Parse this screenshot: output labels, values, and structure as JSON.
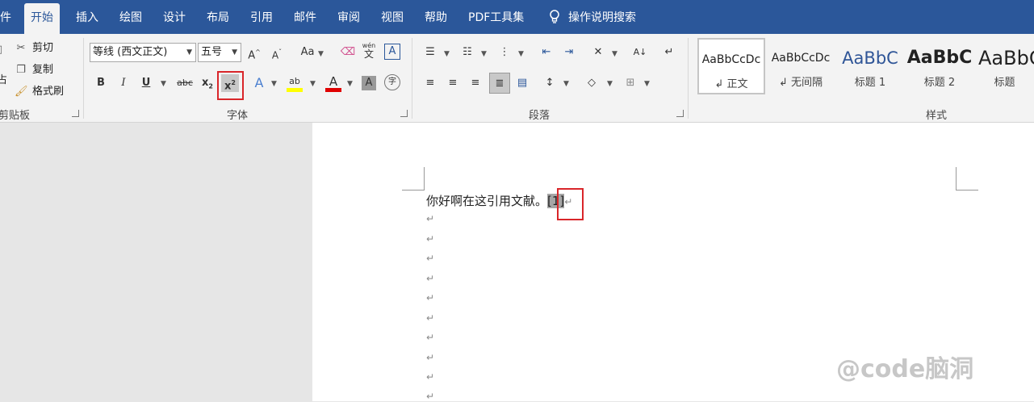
{
  "tabs": [
    {
      "label": "件",
      "active": false
    },
    {
      "label": "开始",
      "active": true
    },
    {
      "label": "插入",
      "active": false
    },
    {
      "label": "绘图",
      "active": false
    },
    {
      "label": "设计",
      "active": false
    },
    {
      "label": "布局",
      "active": false
    },
    {
      "label": "引用",
      "active": false
    },
    {
      "label": "邮件",
      "active": false
    },
    {
      "label": "审阅",
      "active": false
    },
    {
      "label": "视图",
      "active": false
    },
    {
      "label": "帮助",
      "active": false
    },
    {
      "label": "PDF工具集",
      "active": false
    }
  ],
  "search": {
    "label": "操作说明搜索"
  },
  "clipboard": {
    "cut": "剪切",
    "copy": "复制",
    "format_painter": "格式刷",
    "paste_partial": "占",
    "paste_partial2": "占",
    "group_label": "剪贴板"
  },
  "font": {
    "name": "等线 (西文正文)",
    "size": "五号",
    "group_label": "字体",
    "bold": "B",
    "italic": "I",
    "underline": "U",
    "strike": "abc",
    "subscript": "x",
    "superscript": "x",
    "change_case": "Aa",
    "grow": "A",
    "shrink": "A",
    "pinyin_top": "wén",
    "pinyin_bottom": "文",
    "boxed": "A",
    "effects": "A",
    "highlight": "ab",
    "color": "A",
    "shade": "A",
    "enclose": "字"
  },
  "paragraph": {
    "group_label": "段落"
  },
  "styles": {
    "group_label": "样式",
    "items": [
      {
        "sample": "AaBbCcDc",
        "name": "正文",
        "selected": true
      },
      {
        "sample": "AaBbCcDc",
        "name": "无间隔",
        "selected": false
      },
      {
        "sample": "AaBbC",
        "name": "标题 1",
        "selected": false
      },
      {
        "sample": "AaBbC",
        "name": "标题 2",
        "selected": false
      },
      {
        "sample": "AaBbC",
        "name": "标题",
        "selected": false
      }
    ]
  },
  "colors": {
    "accent": "#2b579a",
    "highlight_border": "#d9262a",
    "font_color": "#e00000",
    "highlight_color": "#ffff00"
  },
  "document": {
    "text": "你好啊在这引用文献。",
    "ref": "[1]",
    "para_mark": "↵"
  },
  "watermark": "@code脑洞"
}
